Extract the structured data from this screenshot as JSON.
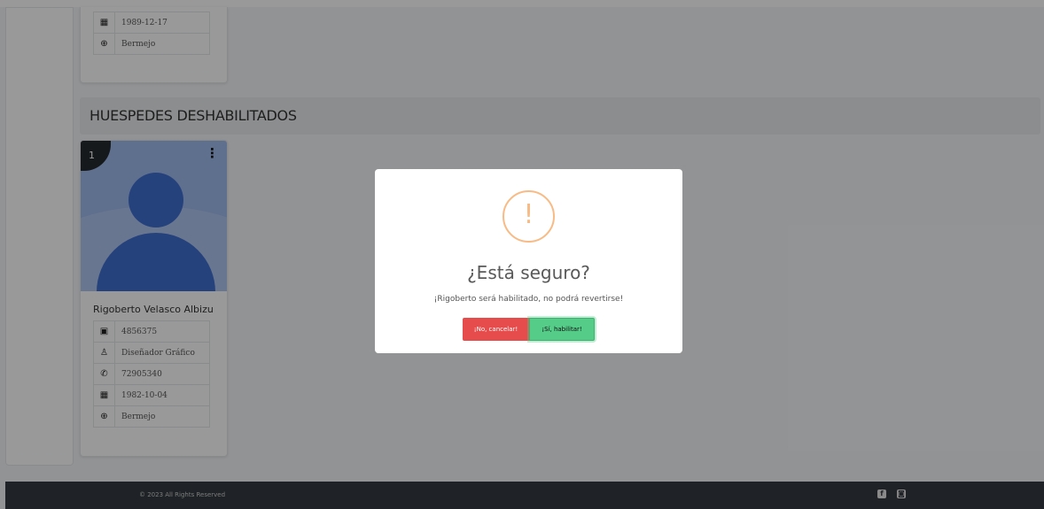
{
  "top_card": {
    "rows": [
      {
        "icon": "calendar-icon",
        "glyph": "▦",
        "value": "1989-12-17"
      },
      {
        "icon": "globe-icon",
        "glyph": "⊕",
        "value": "Bermejo"
      }
    ]
  },
  "section": {
    "title": "HUESPEDES DESHABILITADOS"
  },
  "guest_card": {
    "badge": "1",
    "menu_glyph": "⋮",
    "name": "Rigoberto Velasco Albizu",
    "rows": [
      {
        "icon": "id-card-icon",
        "glyph": "▣",
        "value": "4856375"
      },
      {
        "icon": "user-tie-icon",
        "glyph": "♙",
        "value": "Diseñador Gráfico"
      },
      {
        "icon": "phone-icon",
        "glyph": "✆",
        "value": "72905340"
      },
      {
        "icon": "calendar-icon",
        "glyph": "▦",
        "value": "1982-10-04"
      },
      {
        "icon": "globe-icon",
        "glyph": "⊕",
        "value": "Bermejo"
      }
    ]
  },
  "footer": {
    "copyright": "© 2023 All Rights Reserved",
    "social": [
      {
        "icon": "facebook-icon",
        "glyph": "f"
      },
      {
        "icon": "instagram-icon",
        "glyph": "◙"
      }
    ]
  },
  "modal": {
    "icon": "warning-icon",
    "mark": "!",
    "title": "¿Está seguro?",
    "text": "¡Rigoberto será habilitado, no podrá revertirse!",
    "cancel_label": "¡No, cancelar!",
    "confirm_label": "¡Sí, habilitar!"
  },
  "colors": {
    "avatar_bg": "#9fb9ed",
    "avatar_fg": "#3f6fd1",
    "footer_bg": "#343a40",
    "cancel": "#e74c4c",
    "confirm": "#55cc88",
    "warning": "#f8bb86"
  }
}
